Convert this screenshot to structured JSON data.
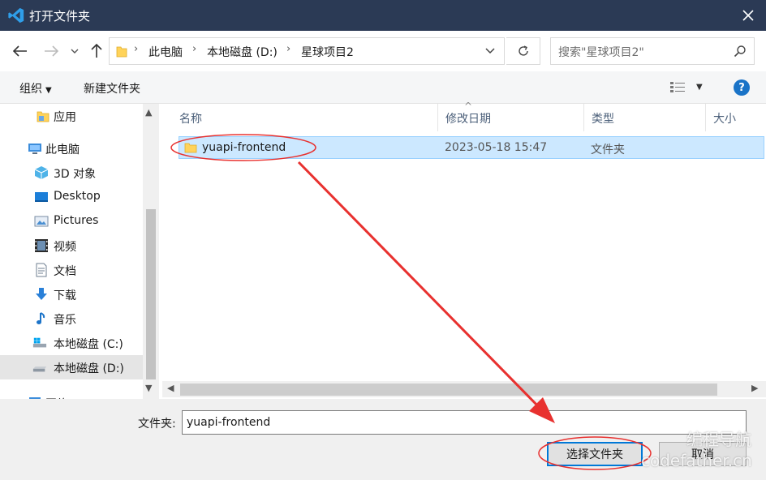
{
  "window": {
    "title": "打开文件夹",
    "close_icon": "close-icon"
  },
  "nav": {
    "back_icon": "arrow-left-icon",
    "forward_icon": "arrow-right-icon",
    "recent_icon": "chevron-down-icon",
    "up_icon": "arrow-up-icon"
  },
  "breadcrumb": [
    "此电脑",
    "本地磁盘 (D:)",
    "星球项目2"
  ],
  "search": {
    "placeholder": "搜索\"星球项目2\""
  },
  "toolbar": {
    "organize": "组织",
    "new_folder": "新建文件夹"
  },
  "sidebar": {
    "items": [
      {
        "label": "应用",
        "icon": "folder-icon"
      },
      {
        "label": "此电脑",
        "icon": "computer-icon"
      },
      {
        "label": "3D 对象",
        "icon": "cube-icon"
      },
      {
        "label": "Desktop",
        "icon": "desktop-icon"
      },
      {
        "label": "Pictures",
        "icon": "pictures-icon"
      },
      {
        "label": "视频",
        "icon": "video-icon"
      },
      {
        "label": "文档",
        "icon": "document-icon"
      },
      {
        "label": "下载",
        "icon": "download-icon"
      },
      {
        "label": "音乐",
        "icon": "music-icon"
      },
      {
        "label": "本地磁盘 (C:)",
        "icon": "drive-c-icon"
      },
      {
        "label": "本地磁盘 (D:)",
        "icon": "drive-d-icon",
        "selected": true
      },
      {
        "label": "网络",
        "icon": "network-icon"
      }
    ]
  },
  "list": {
    "columns": [
      "名称",
      "修改日期",
      "类型",
      "大小"
    ],
    "rows": [
      {
        "name": "yuapi-frontend",
        "modified": "2023-05-18 15:47",
        "type": "文件夹",
        "size": ""
      }
    ]
  },
  "footer": {
    "folder_label": "文件夹:",
    "folder_value": "yuapi-frontend",
    "select_button": "选择文件夹",
    "cancel_button": "取消"
  },
  "watermark": {
    "line1": "编程导航",
    "line2": "codefather.cn"
  },
  "colors": {
    "titlebar": "#2b3a55",
    "selection": "#cce8ff",
    "accent": "#0078d7",
    "annotation": "#e8312f"
  }
}
